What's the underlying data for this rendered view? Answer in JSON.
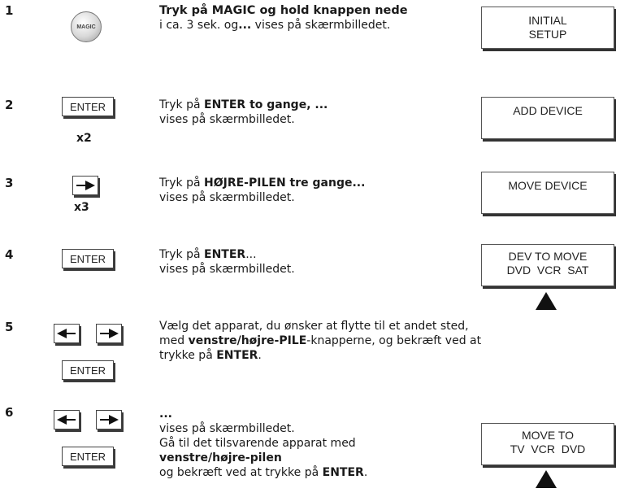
{
  "steps": [
    {
      "number": "1",
      "button": "MAGIC",
      "text": {
        "bold": "Tryk på MAGIC og hold knappen nede",
        "line2": "i ca. 3 sek. og",
        "line2_bold": "...",
        "line2_end": " vises på skærmbilledet."
      },
      "screen": [
        "INITIAL",
        "SETUP"
      ]
    },
    {
      "number": "2",
      "button": "ENTER",
      "multiplier": "x2",
      "text": {
        "pre": "Tryk på ",
        "bold": "ENTER to gange, ...",
        "line2": "vises på skærmbilledet."
      },
      "screen": [
        "ADD DEVICE"
      ]
    },
    {
      "number": "3",
      "button": "right-arrow",
      "multiplier": "x3",
      "text": {
        "pre": "Tryk på ",
        "bold": "HØJRE-PILEN tre gange...",
        "line2": "vises på skærmbilledet."
      },
      "screen": [
        "MOVE DEVICE"
      ]
    },
    {
      "number": "4",
      "button": "ENTER",
      "text": {
        "pre": "Tryk på ",
        "bold": "ENTER",
        "post": "...",
        "line2": "vises på skærmbilledet."
      },
      "screen": [
        "DEV TO MOVE",
        "DVD  VCR  SAT"
      ]
    },
    {
      "number": "5",
      "buttons": [
        "left-arrow",
        "right-arrow",
        "ENTER"
      ],
      "text": {
        "line1": "Vælg det apparat, du ønsker at flytte til et andet sted,",
        "line2_pre": "med ",
        "line2_bold": "venstre/højre-PILE",
        "line2_post": "-knapperne, og bekræft ved at",
        "line3_pre": "trykke på ",
        "line3_bold": "ENTER",
        "line3_post": "."
      }
    },
    {
      "number": "6",
      "buttons": [
        "left-arrow",
        "right-arrow",
        "ENTER"
      ],
      "text": {
        "line1_bold": "...",
        "line2": "vises på skærmbilledet.",
        "line3": "Gå til det tilsvarende apparat med",
        "line4_bold": "venstre/højre-pilen",
        "line5_pre": "og bekræft ved at trykke på ",
        "line5_bold": "ENTER",
        "line5_post": "."
      },
      "screen": [
        "MOVE TO",
        "TV  VCR  DVD"
      ]
    }
  ]
}
